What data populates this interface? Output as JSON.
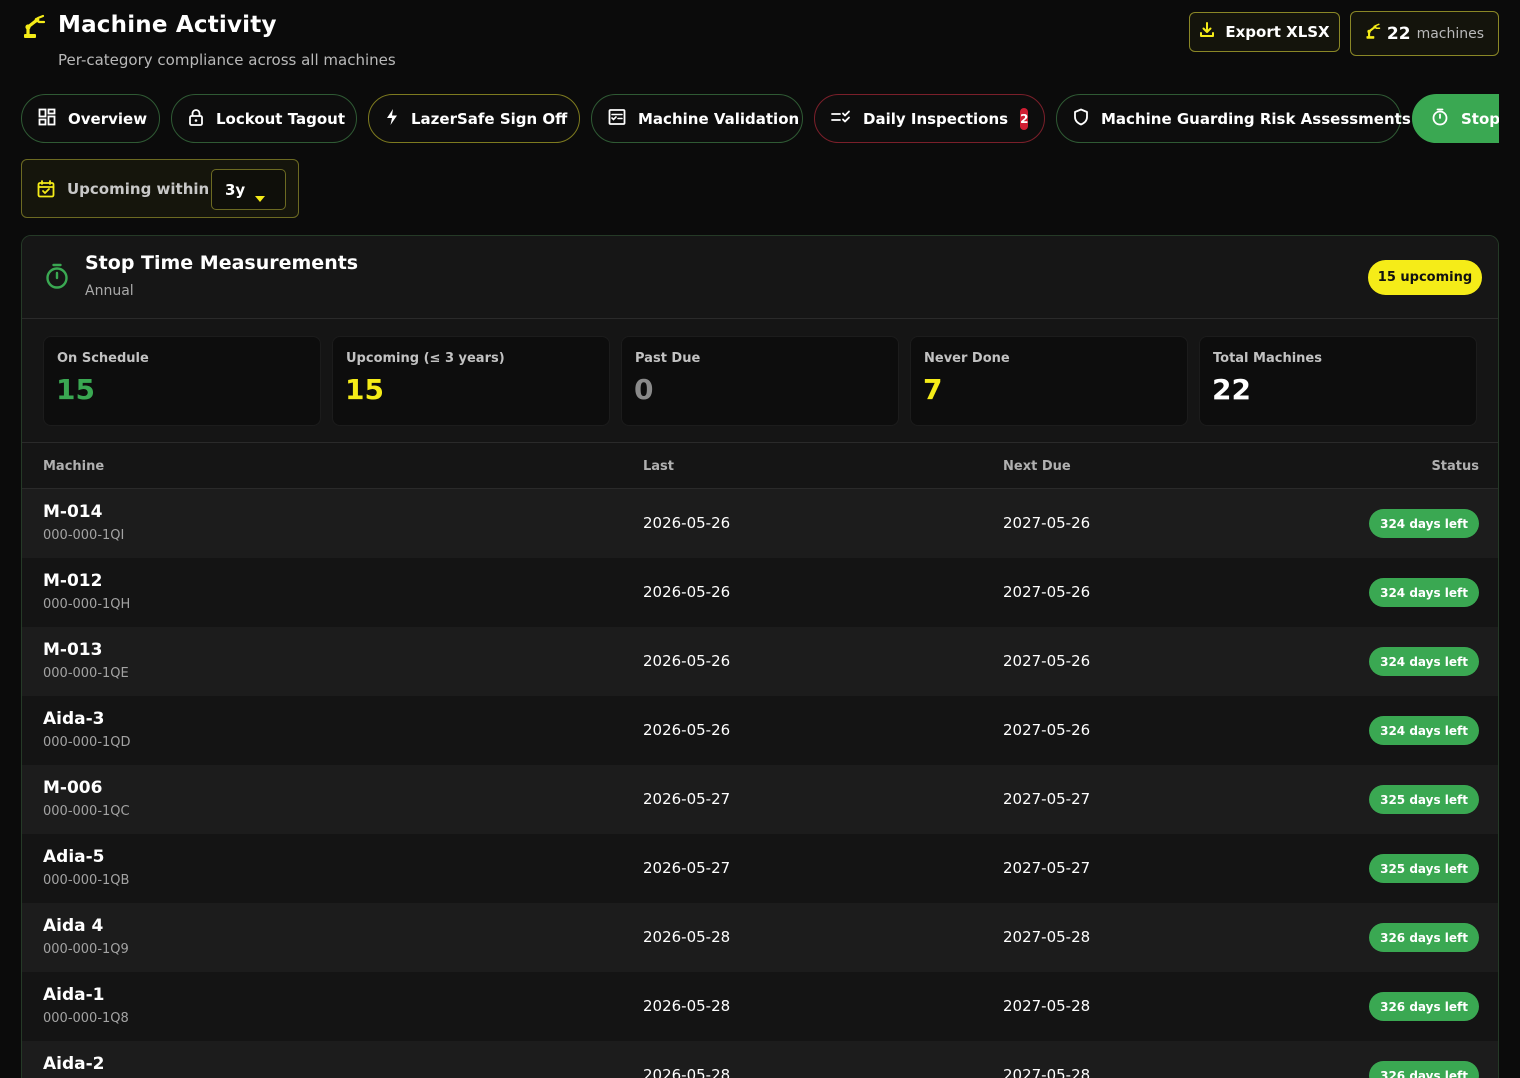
{
  "header": {
    "title": "Machine Activity",
    "subtitle": "Per-category compliance across all machines",
    "export_label": "Export XLSX",
    "machine_count": "22",
    "machine_word": "machines"
  },
  "tabs": [
    {
      "label": "Overview",
      "icon": "grid-icon"
    },
    {
      "label": "Lockout Tagout",
      "icon": "lock-icon"
    },
    {
      "label": "LazerSafe Sign Off",
      "icon": "bolt-icon"
    },
    {
      "label": "Machine Validation",
      "icon": "checklist-icon"
    },
    {
      "label": "Daily Inspections",
      "icon": "list-check-icon",
      "badge": "2"
    },
    {
      "label": "Machine Guarding Risk Assessments",
      "icon": "shield-icon"
    },
    {
      "label": "Stop",
      "icon": "timer-icon",
      "active": true
    }
  ],
  "filter": {
    "label": "Upcoming within",
    "value": "3y"
  },
  "panel": {
    "title": "Stop Time Measurements",
    "subtitle": "Annual",
    "upcoming_pill": "15 upcoming"
  },
  "stats": [
    {
      "label": "On Schedule",
      "value": "15",
      "color": "#3aa852"
    },
    {
      "label": "Upcoming (≤ 3 years)",
      "value": "15",
      "color": "#f5ec18"
    },
    {
      "label": "Past Due",
      "value": "0",
      "color": "#8a8a8a"
    },
    {
      "label": "Never Done",
      "value": "7",
      "color": "#f5ec18"
    },
    {
      "label": "Total Machines",
      "value": "22",
      "color": "#ffffff"
    }
  ],
  "table": {
    "columns": [
      "Machine",
      "Last",
      "Next Due",
      "Status"
    ],
    "rows": [
      {
        "name": "M-014",
        "id": "000-000-1QI",
        "last": "2026-05-26",
        "next": "2027-05-26",
        "status": "324 days left"
      },
      {
        "name": "M-012",
        "id": "000-000-1QH",
        "last": "2026-05-26",
        "next": "2027-05-26",
        "status": "324 days left"
      },
      {
        "name": "M-013",
        "id": "000-000-1QE",
        "last": "2026-05-26",
        "next": "2027-05-26",
        "status": "324 days left"
      },
      {
        "name": "Aida-3",
        "id": "000-000-1QD",
        "last": "2026-05-26",
        "next": "2027-05-26",
        "status": "324 days left"
      },
      {
        "name": "M-006",
        "id": "000-000-1QC",
        "last": "2026-05-27",
        "next": "2027-05-27",
        "status": "325 days left"
      },
      {
        "name": "Adia-5",
        "id": "000-000-1QB",
        "last": "2026-05-27",
        "next": "2027-05-27",
        "status": "325 days left"
      },
      {
        "name": "Aida 4",
        "id": "000-000-1Q9",
        "last": "2026-05-28",
        "next": "2027-05-28",
        "status": "326 days left"
      },
      {
        "name": "Aida-1",
        "id": "000-000-1Q8",
        "last": "2026-05-28",
        "next": "2027-05-28",
        "status": "326 days left"
      },
      {
        "name": "Aida-2",
        "id": "",
        "last": "2026-05-28",
        "next": "2027-05-28",
        "status": "326 days left"
      }
    ]
  },
  "colors": {
    "accent_yellow": "#f5ec18",
    "accent_green": "#3aa852",
    "alert_red": "#d01e33"
  }
}
